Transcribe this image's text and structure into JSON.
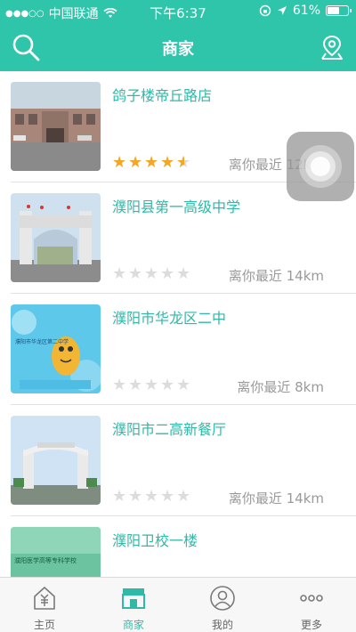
{
  "status_bar": {
    "carrier": "中国联通",
    "time": "下午6:37",
    "battery": "61%"
  },
  "header": {
    "title": "商家",
    "left_icon": "search-icon",
    "right_icon": "location-icon"
  },
  "merchants": [
    {
      "name": "鸽子楼帝丘路店",
      "rating": 4.5,
      "distance": "离你最近 12km"
    },
    {
      "name": "濮阳县第一高级中学",
      "rating": 0,
      "distance": "离你最近 14km"
    },
    {
      "name": "濮阳市华龙区二中",
      "rating": 0,
      "distance": "离你最近 8km"
    },
    {
      "name": "濮阳市二高新餐厅",
      "rating": 0,
      "distance": "离你最近 14km"
    },
    {
      "name": "濮阳卫校一楼",
      "rating": 0,
      "distance": ""
    }
  ],
  "thumbs": {
    "t3": "濮阳市华龙区第二中学",
    "t5": "濮阳医学高等专科学校"
  },
  "tabs": [
    {
      "label": "主页",
      "icon": "home-icon"
    },
    {
      "label": "商家",
      "icon": "store-icon"
    },
    {
      "label": "我的",
      "icon": "user-icon"
    },
    {
      "label": "更多",
      "icon": "more-icon"
    }
  ],
  "colors": {
    "primary": "#2fc5ab",
    "star": "#f5a623",
    "text_muted": "#9a9a9a"
  }
}
